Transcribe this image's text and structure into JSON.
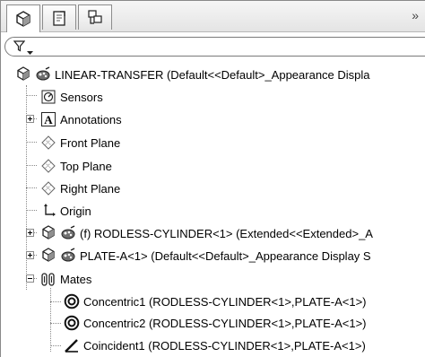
{
  "tabs": [
    {
      "icon": "feature-manager-icon"
    },
    {
      "icon": "property-manager-icon"
    },
    {
      "icon": "configuration-manager-icon"
    }
  ],
  "more_label": "»",
  "filter": {
    "icon": "filter-icon"
  },
  "tree": {
    "root": {
      "label": "LINEAR-TRANSFER  (Default<<Default>_Appearance Displa"
    },
    "items": [
      {
        "label": "Sensors"
      },
      {
        "label": "Annotations"
      },
      {
        "label": "Front Plane"
      },
      {
        "label": "Top Plane"
      },
      {
        "label": "Right Plane"
      },
      {
        "label": "Origin"
      },
      {
        "label": "(f) RODLESS-CYLINDER<1> (Extended<<Extended>_A"
      },
      {
        "label": "PLATE-A<1> (Default<<Default>_Appearance Display S"
      },
      {
        "label": "Mates"
      }
    ],
    "mates": [
      {
        "label": "Concentric1 (RODLESS-CYLINDER<1>,PLATE-A<1>)"
      },
      {
        "label": "Concentric2 (RODLESS-CYLINDER<1>,PLATE-A<1>)"
      },
      {
        "label": "Coincident1 (RODLESS-CYLINDER<1>,PLATE-A<1>)"
      }
    ]
  }
}
